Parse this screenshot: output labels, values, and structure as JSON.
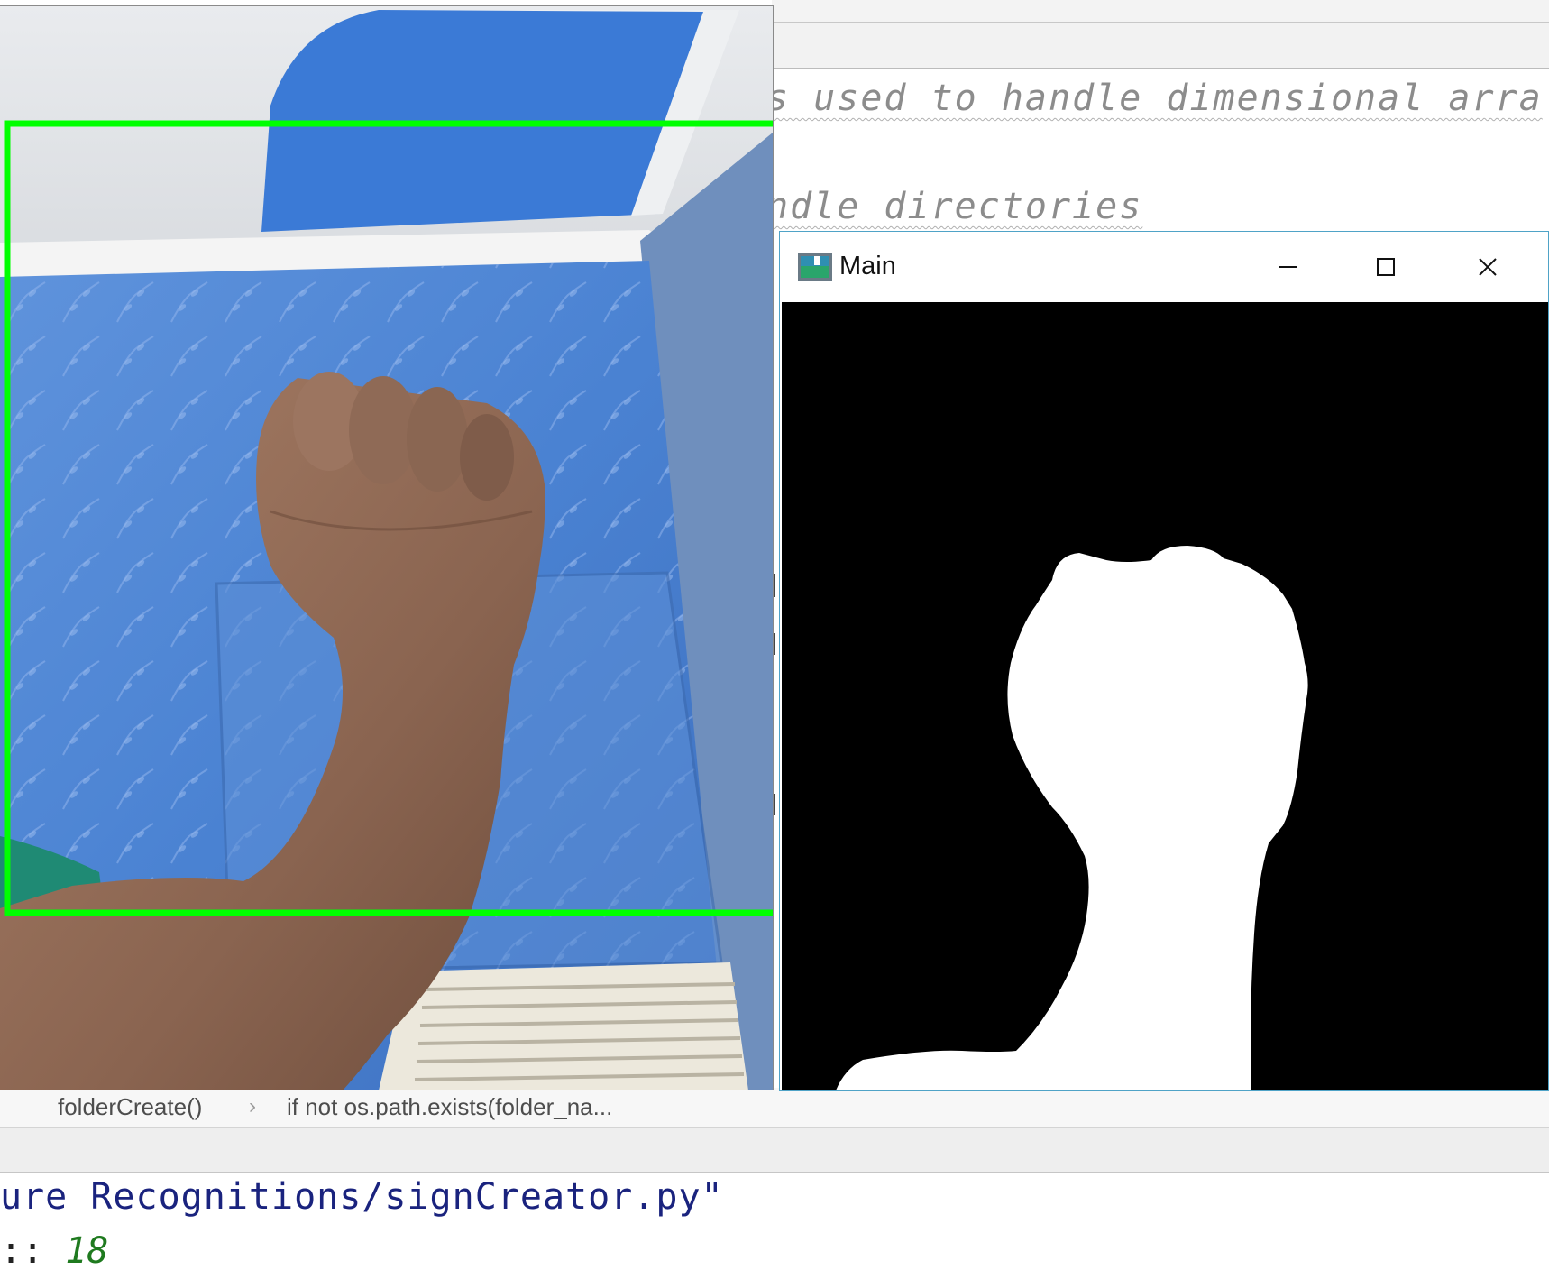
{
  "editor": {
    "comment_line_1": "s used to handle dimensional arra",
    "comment_line_2": "ndle directories"
  },
  "breadcrumb": {
    "function": "folderCreate()",
    "separator": "›",
    "statement": "if not os.path.exists(folder_na..."
  },
  "console": {
    "path_line": "ure Recognitions/signCreator.py\"",
    "input_prefix": ":: ",
    "input_value": "18"
  },
  "mask_window": {
    "title": "Main",
    "icon": "app-window-icon",
    "controls": [
      "minimize-icon",
      "maximize-icon",
      "close-icon"
    ]
  },
  "camera": {
    "roi_color": "#00ff00",
    "roi": "fist-region"
  },
  "colors": {
    "mask_background": "#000000",
    "mask_foreground": "#ffffff",
    "window_border": "#4fa3c7",
    "console_path": "#1a237e",
    "console_value": "#1f7a1f"
  }
}
